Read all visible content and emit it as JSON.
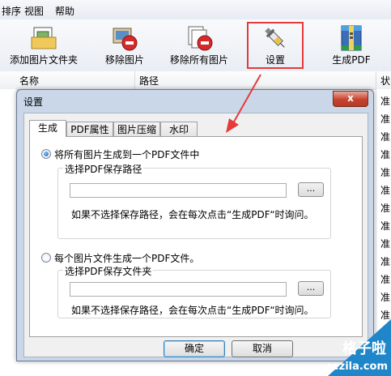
{
  "menu": [
    "排序",
    "视图",
    "帮助"
  ],
  "toolbar": {
    "add_folder": "添加图片文件夹",
    "remove_image": "移除图片",
    "remove_all": "移除所有图片",
    "settings": "设置",
    "generate": "生成PDF"
  },
  "list": {
    "col_name": "名称",
    "col_path": "路径",
    "col_status": "状",
    "row_status": "准"
  },
  "dialog": {
    "title": "设置",
    "close": "x",
    "tabs": [
      "生成",
      "PDF属性",
      "图片压缩",
      "水印"
    ],
    "option1": {
      "label": "将所有图片生成到一个PDF文件中",
      "selected": true,
      "group_title": "选择PDF保存路径",
      "path_value": "",
      "browse": "...",
      "hint": "如果不选择保存路径，会在每次点击“生成PDF“时询问。"
    },
    "option2": {
      "label": "每个图片文件生成一个PDF文件。",
      "selected": false,
      "group_title": "选择PDF保存文件夹",
      "path_value": "",
      "browse": "...",
      "hint": "如果不选择保存路径，会在每次点击“生成PDF“时询问。"
    },
    "ok": "确定",
    "cancel": "取消"
  },
  "watermark": {
    "line1": "格子啦",
    "line2": "gezila.com"
  },
  "colors": {
    "highlight": "#e53a3a",
    "arrow": "#e53a3a",
    "watermark_bg": "#1f86c9"
  }
}
